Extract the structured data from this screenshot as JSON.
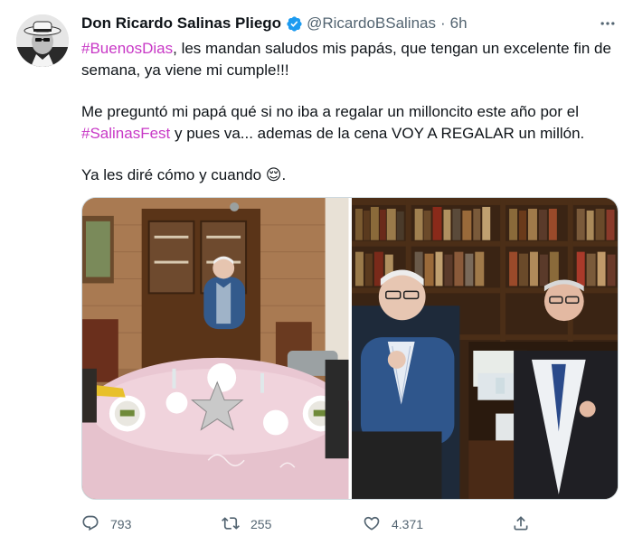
{
  "tweet": {
    "author": {
      "name": "Don Ricardo Salinas Pliego",
      "handle": "@RicardoBSalinas",
      "separator": "·",
      "time": "6h"
    },
    "paragraph1": {
      "hashtag": "#BuenosDias",
      "text": ", les mandan saludos mis papás, que tengan un excelente fin de semana, ya viene mi cumple!!!"
    },
    "paragraph2": {
      "before": "Me preguntó mi papá qué si no iba a regalar un milloncito este año por el ",
      "hashtag": "#SalinasFest",
      "after": " y pues va... ademas de la cena VOY A REGALAR un millón."
    },
    "paragraph3": {
      "text": "Ya les diré cómo y cuando ",
      "emoji": "😌",
      "end": "."
    },
    "actions": {
      "replies": "793",
      "retweets": "255",
      "likes": "4.371"
    }
  },
  "colors": {
    "hashtag": "#c838c6",
    "verified": "#1d9bf0",
    "muted": "#536471",
    "text": "#0f1419"
  },
  "icons": [
    "avatar-photo",
    "verified-badge-icon",
    "more-icon",
    "reply-icon",
    "retweet-icon",
    "like-icon",
    "share-icon"
  ]
}
